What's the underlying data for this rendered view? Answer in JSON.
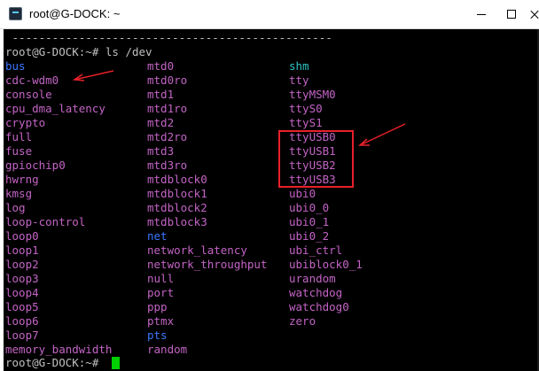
{
  "window": {
    "title": "root@G-DOCK: ~",
    "icon": "terminal-icon"
  },
  "terminal": {
    "separator": " ------------------------------------------------",
    "command_line": "root@G-DOCK:~# ls /dev",
    "prompt_line": "root@G-DOCK:~# ",
    "entries": [
      [
        {
          "t": "bus",
          "c": "blue"
        },
        {
          "t": "mtd0",
          "c": "pink"
        },
        {
          "t": "shm",
          "c": "cyan"
        }
      ],
      [
        {
          "t": "cdc-wdm0",
          "c": "pink"
        },
        {
          "t": "mtd0ro",
          "c": "pink"
        },
        {
          "t": "tty",
          "c": "pink"
        }
      ],
      [
        {
          "t": "console",
          "c": "pink"
        },
        {
          "t": "mtd1",
          "c": "pink"
        },
        {
          "t": "ttyMSM0",
          "c": "pink"
        }
      ],
      [
        {
          "t": "cpu_dma_latency",
          "c": "pink"
        },
        {
          "t": "mtd1ro",
          "c": "pink"
        },
        {
          "t": "ttyS0",
          "c": "pink"
        }
      ],
      [
        {
          "t": "crypto",
          "c": "pink"
        },
        {
          "t": "mtd2",
          "c": "pink"
        },
        {
          "t": "ttyS1",
          "c": "pink"
        }
      ],
      [
        {
          "t": "full",
          "c": "pink"
        },
        {
          "t": "mtd2ro",
          "c": "pink"
        },
        {
          "t": "ttyUSB0",
          "c": "pink"
        }
      ],
      [
        {
          "t": "fuse",
          "c": "pink"
        },
        {
          "t": "mtd3",
          "c": "pink"
        },
        {
          "t": "ttyUSB1",
          "c": "pink"
        }
      ],
      [
        {
          "t": "gpiochip0",
          "c": "pink"
        },
        {
          "t": "mtd3ro",
          "c": "pink"
        },
        {
          "t": "ttyUSB2",
          "c": "pink"
        }
      ],
      [
        {
          "t": "hwrng",
          "c": "pink"
        },
        {
          "t": "mtdblock0",
          "c": "pink"
        },
        {
          "t": "ttyUSB3",
          "c": "pink"
        }
      ],
      [
        {
          "t": "kmsg",
          "c": "pink"
        },
        {
          "t": "mtdblock1",
          "c": "pink"
        },
        {
          "t": "ubi0",
          "c": "pink"
        }
      ],
      [
        {
          "t": "log",
          "c": "pink"
        },
        {
          "t": "mtdblock2",
          "c": "pink"
        },
        {
          "t": "ubi0_0",
          "c": "pink"
        }
      ],
      [
        {
          "t": "loop-control",
          "c": "pink"
        },
        {
          "t": "mtdblock3",
          "c": "pink"
        },
        {
          "t": "ubi0_1",
          "c": "pink"
        }
      ],
      [
        {
          "t": "loop0",
          "c": "pink"
        },
        {
          "t": "net",
          "c": "blue"
        },
        {
          "t": "ubi0_2",
          "c": "pink"
        }
      ],
      [
        {
          "t": "loop1",
          "c": "pink"
        },
        {
          "t": "network_latency",
          "c": "pink"
        },
        {
          "t": "ubi_ctrl",
          "c": "pink"
        }
      ],
      [
        {
          "t": "loop2",
          "c": "pink"
        },
        {
          "t": "network_throughput",
          "c": "pink"
        },
        {
          "t": "ubiblock0_1",
          "c": "pink"
        }
      ],
      [
        {
          "t": "loop3",
          "c": "pink"
        },
        {
          "t": "null",
          "c": "pink"
        },
        {
          "t": "urandom",
          "c": "pink"
        }
      ],
      [
        {
          "t": "loop4",
          "c": "pink"
        },
        {
          "t": "port",
          "c": "pink"
        },
        {
          "t": "watchdog",
          "c": "pink"
        }
      ],
      [
        {
          "t": "loop5",
          "c": "pink"
        },
        {
          "t": "ppp",
          "c": "pink"
        },
        {
          "t": "watchdog0",
          "c": "pink"
        }
      ],
      [
        {
          "t": "loop6",
          "c": "pink"
        },
        {
          "t": "ptmx",
          "c": "pink"
        },
        {
          "t": "zero",
          "c": "pink"
        }
      ],
      [
        {
          "t": "loop7",
          "c": "pink"
        },
        {
          "t": "pts",
          "c": "blue"
        },
        {
          "t": "",
          "c": "pink"
        }
      ],
      [
        {
          "t": "memory_bandwidth",
          "c": "pink"
        },
        {
          "t": "random",
          "c": "pink"
        },
        {
          "t": "",
          "c": "pink"
        }
      ]
    ]
  },
  "colors": {
    "terminal_bg": "#000000",
    "text": "#c0c0c0",
    "pink": "#c364c5",
    "blue": "#3b78ff",
    "cyan": "#2fc3c5",
    "cursor": "#00d000",
    "annotation_red": "#e8202a"
  },
  "annotations": {
    "highlighted_entries": [
      "ttyUSB0",
      "ttyUSB1",
      "ttyUSB2",
      "ttyUSB3"
    ],
    "arrow_targets": [
      "cdc-wdm0",
      "ttyUSB0"
    ]
  }
}
